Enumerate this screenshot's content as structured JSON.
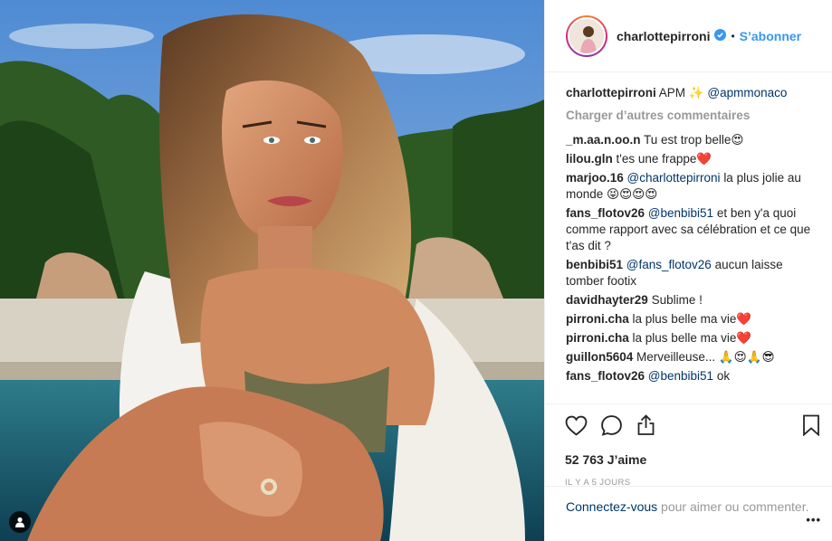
{
  "header": {
    "username": "charlottepirroni",
    "separator": "•",
    "follow_label": "S’abonner"
  },
  "caption": {
    "user": "charlottepirroni",
    "text": "APM ✨",
    "mention": "@apmmonaco"
  },
  "load_more_label": "Charger d’autres commentaires",
  "comments": [
    {
      "user": "_m.aa.n.oo.n",
      "mention": "",
      "text": "Tu est trop belle😍"
    },
    {
      "user": "lilou.gln",
      "mention": "",
      "text": "t'es une frappe❤️"
    },
    {
      "user": "marjoo.16",
      "mention": "@charlottepirroni",
      "text": "la plus jolie au monde 😝😍😍😍"
    },
    {
      "user": "fans_flotov26",
      "mention": "@benbibi51",
      "text": "et ben y'a quoi comme rapport avec sa célébration et ce que t'as dit ?"
    },
    {
      "user": "benbibi51",
      "mention": "@fans_flotov26",
      "text": "aucun laisse tomber footix"
    },
    {
      "user": "davidhayter29",
      "mention": "",
      "text": "Sublime !"
    },
    {
      "user": "pirroni.cha",
      "mention": "",
      "text": "la plus belle ma vie❤️"
    },
    {
      "user": "pirroni.cha",
      "mention": "",
      "text": "la plus belle ma vie❤️"
    },
    {
      "user": "guillon5604",
      "mention": "",
      "text": "Merveilleuse... 🙏😍🙏😎"
    },
    {
      "user": "fans_flotov26",
      "mention": "@benbibi51",
      "text": "ok"
    }
  ],
  "likes": "52 763 J’aime",
  "date": "IL Y A 5 JOURS",
  "login": {
    "link": "Connectez-vous",
    "text": " pour aimer ou commenter."
  },
  "more_label": "•••",
  "icons": {
    "like": "heart-icon",
    "comment": "comment-icon",
    "share": "share-icon",
    "save": "bookmark-icon",
    "tag": "user-tag-icon",
    "verified": "verified-badge-icon"
  },
  "colors": {
    "accent": "#3897f0",
    "mention": "#003569",
    "muted": "#999999"
  }
}
